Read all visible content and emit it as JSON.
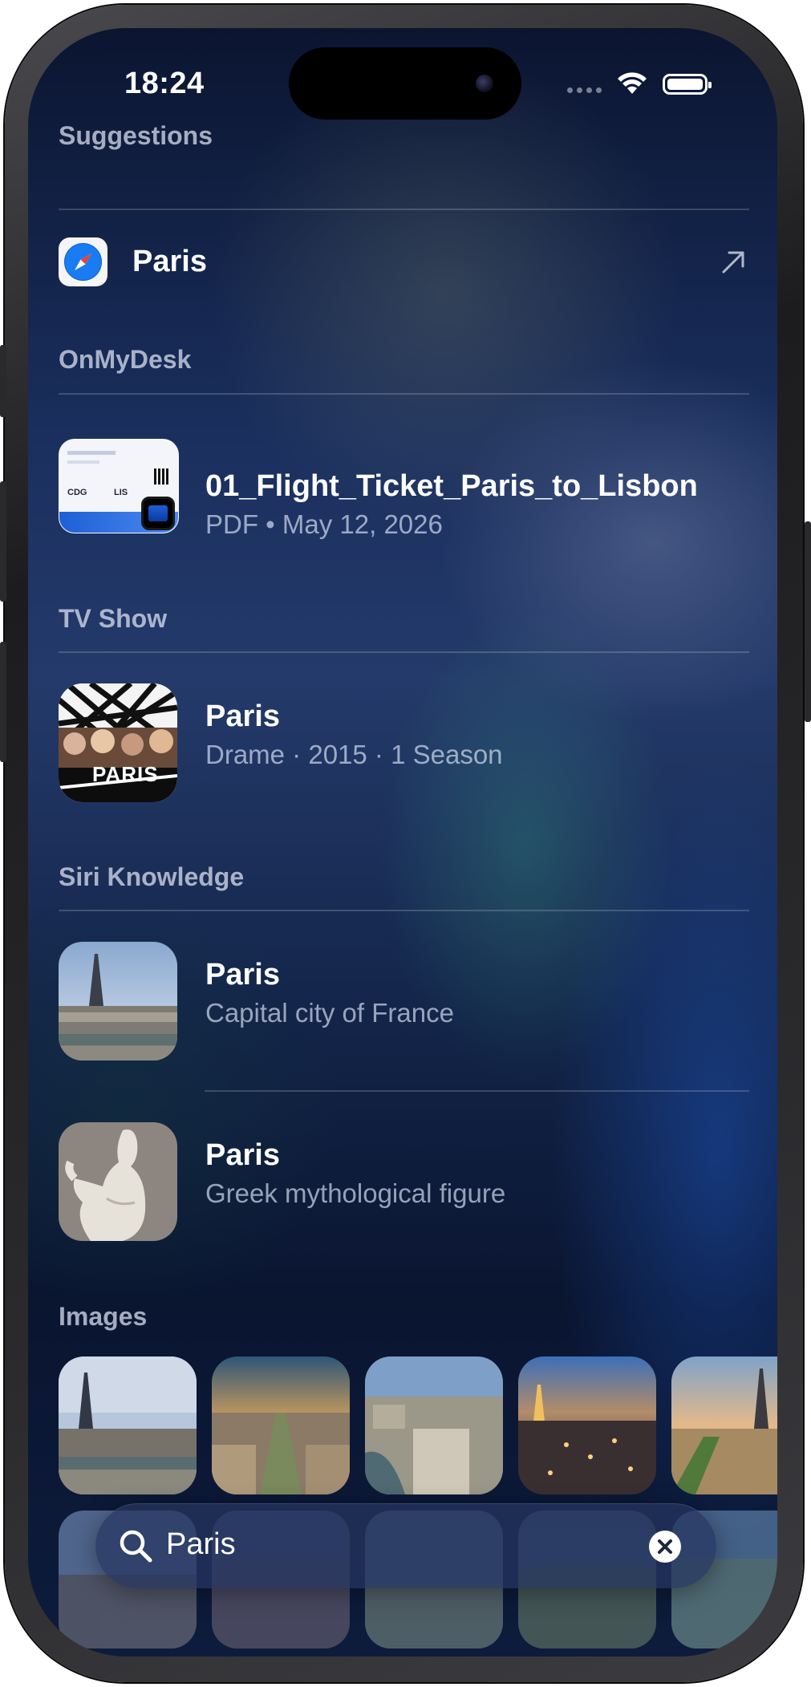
{
  "status_bar": {
    "time": "18:24"
  },
  "sections": {
    "suggestions": {
      "header": "Suggestions",
      "item": {
        "label": "Paris"
      }
    },
    "onmydesk": {
      "header": "OnMyDesk",
      "item": {
        "title": "01_Flight_Ticket_Paris_to_Lisbon",
        "subtitle": "PDF • May 12, 2026",
        "thumb_text": {
          "a": "CDG",
          "b": "LIS"
        }
      }
    },
    "tvshow": {
      "header": "TV Show",
      "item": {
        "title": "Paris",
        "subtitle": "Drame · 2015 · 1 Season",
        "poster_text": "PARIS"
      }
    },
    "siri": {
      "header": "Siri Knowledge",
      "items": [
        {
          "title": "Paris",
          "subtitle": "Capital city of France"
        },
        {
          "title": "Paris",
          "subtitle": "Greek mythological figure"
        }
      ]
    },
    "images": {
      "header": "Images"
    }
  },
  "search": {
    "query": "Paris"
  },
  "colors": {
    "accent": "#1a7cf2",
    "background": "#13254a"
  }
}
